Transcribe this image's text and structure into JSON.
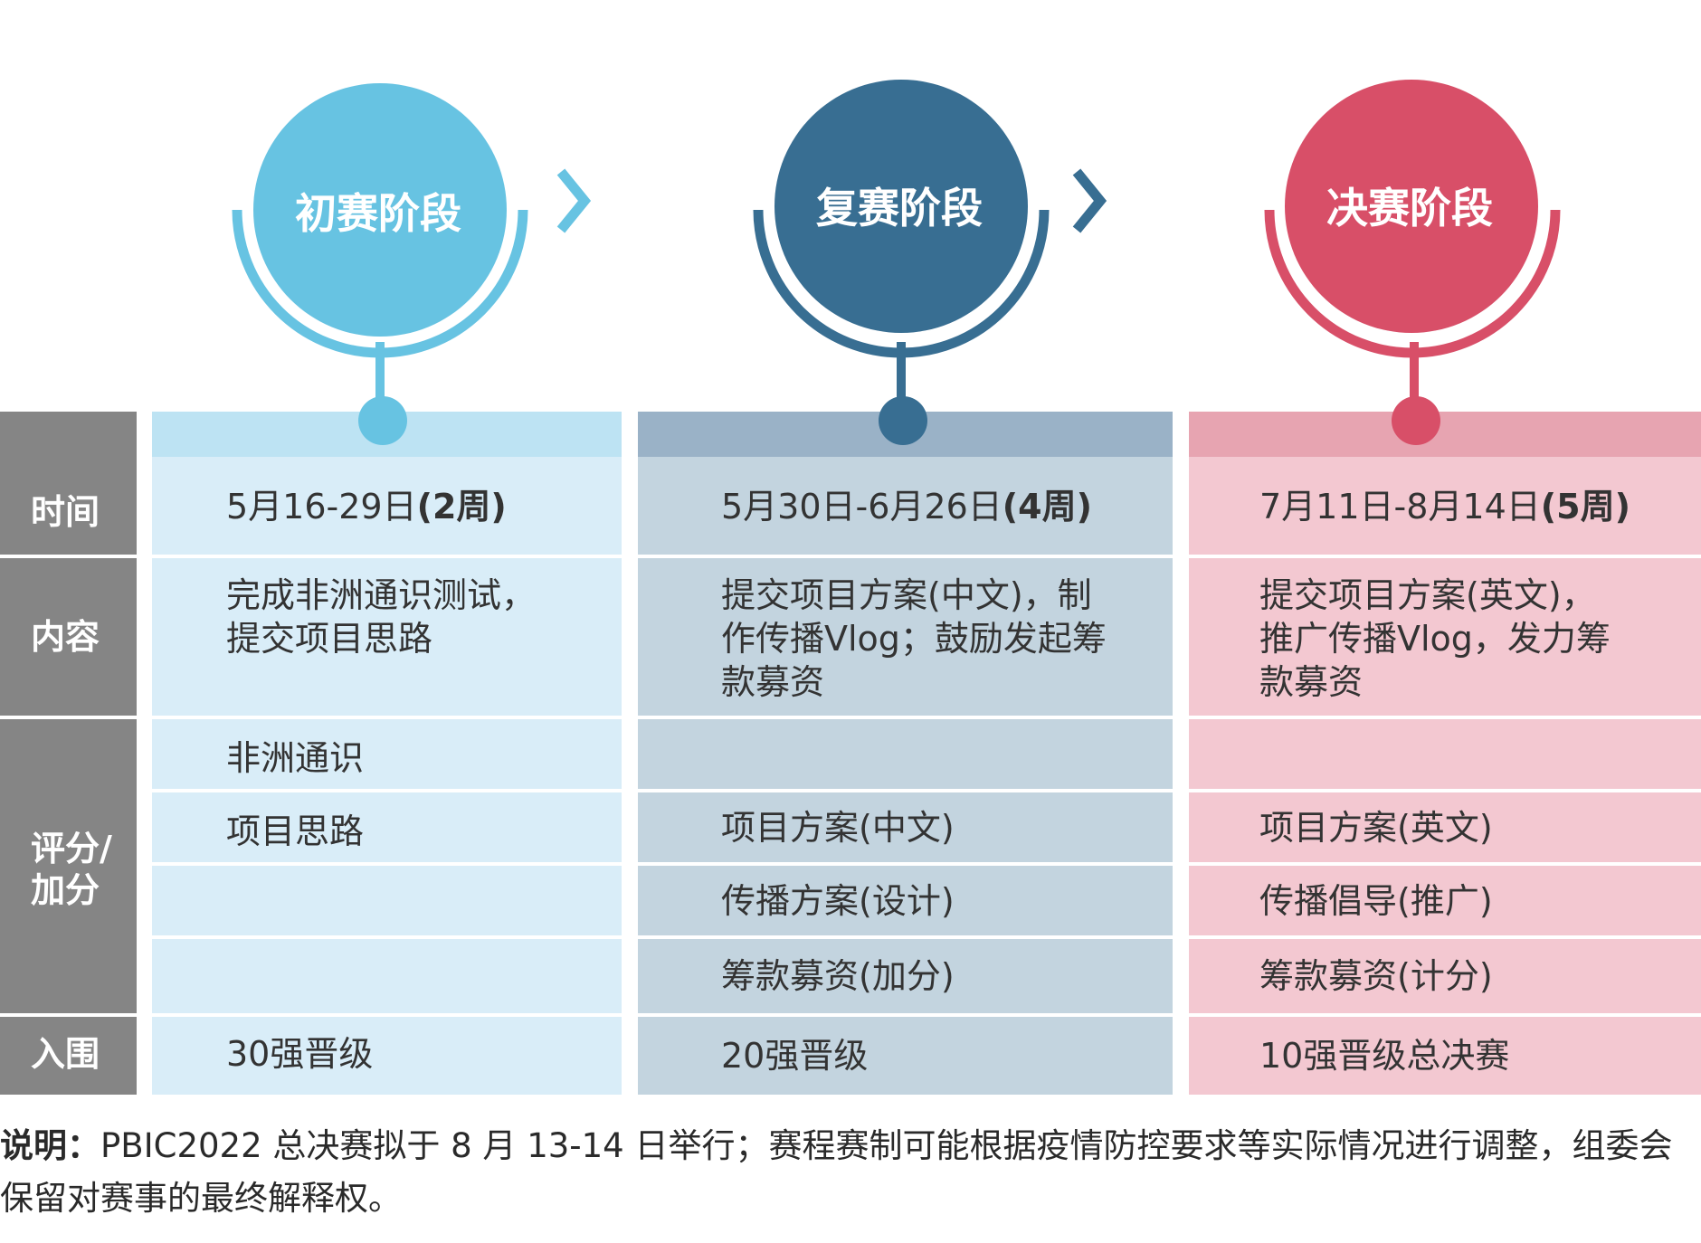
{
  "stages": [
    {
      "title": "初赛阶段",
      "color": "#67c3e2",
      "header_band_color": "#bde3f3",
      "cell_color": "#d9edf8",
      "time": "5月16-29日",
      "time_weeks": "(2周)",
      "content_lines": [
        "完成非洲通识测试，",
        "提交项目思路"
      ],
      "scores": [
        "非洲通识",
        "项目思路",
        "",
        ""
      ],
      "advance": "30强晋级"
    },
    {
      "title": "复赛阶段",
      "color": "#386e92",
      "header_band_color": "#9ab2c7",
      "cell_color": "#c3d4df",
      "time": "5月30日-6月26日",
      "time_weeks": "(4周)",
      "content_lines": [
        "提交项目方案(中文)，制",
        "作传播Vlog；鼓励发起筹",
        "款募资"
      ],
      "scores": [
        "",
        "项目方案(中文)",
        "传播方案(设计)",
        "筹款募资(加分)"
      ],
      "advance": "20强晋级"
    },
    {
      "title": "决赛阶段",
      "color": "#d84f68",
      "header_band_color": "#e7a4b1",
      "cell_color": "#f3c8d1",
      "time": "7月11日-8月14日",
      "time_weeks": "(5周)",
      "content_lines": [
        "提交项目方案(英文)，",
        "推广传播Vlog，发力筹",
        "款募资"
      ],
      "scores": [
        "",
        "项目方案(英文)",
        "传播倡导(推广)",
        "筹款募资(计分)"
      ],
      "advance": "10强晋级总决赛"
    }
  ],
  "row_labels": {
    "time": "时间",
    "content": "内容",
    "score_line1": "评分/",
    "score_line2": "加分",
    "advance": "入围"
  },
  "arrow_color": "#67c3e2",
  "arrow2_color": "#386e92",
  "header_color": "#858585",
  "note": {
    "label": "说明：",
    "text": "PBIC2022 总决赛拟于 8 月 13-14 日举行；赛程赛制可能根据疫情防控要求等实际情况进行调整，组委会保留对赛事的最终解释权。"
  }
}
